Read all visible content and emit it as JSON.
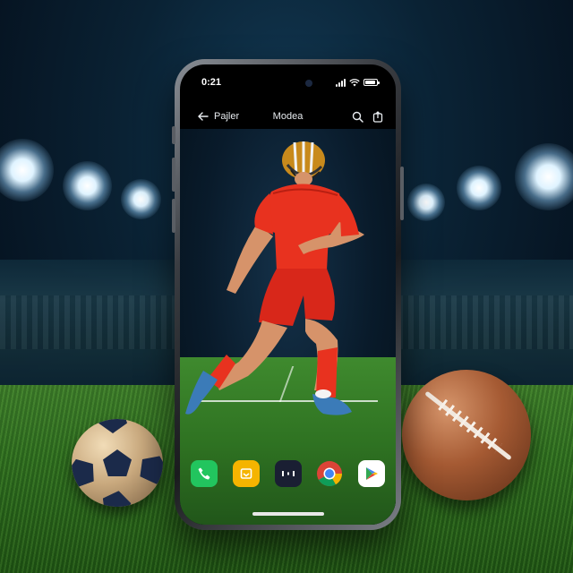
{
  "status_bar": {
    "time": "0:21"
  },
  "app_header": {
    "back_label": "Pajler",
    "title": "Modea"
  },
  "dock": {
    "apps": [
      {
        "name": "phone-app-icon",
        "glyph": "✆",
        "color": "#22c55e"
      },
      {
        "name": "files-app-icon",
        "glyph": "▣",
        "color": "#f5b400"
      },
      {
        "name": "launcher-app-icon",
        "glyph": "⁞⁞",
        "color": "#1a1f33"
      },
      {
        "name": "chrome-app-icon",
        "glyph": "",
        "color": "#ffffff"
      },
      {
        "name": "play-store-app-icon",
        "glyph": "",
        "color": "#ffffff"
      }
    ]
  },
  "colors": {
    "jersey": "#e8321f",
    "helmet": "#c88a1c",
    "pitch": "#3f8a2e"
  }
}
